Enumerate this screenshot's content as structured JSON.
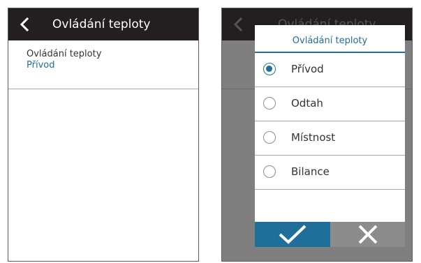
{
  "left_screen": {
    "header": {
      "title": "Ovládání teploty",
      "back_icon": "chevron-left-icon"
    },
    "setting": {
      "label": "Ovládání teploty",
      "value": "Přívod"
    }
  },
  "right_screen": {
    "header": {
      "title": "Ovládání teploty",
      "back_icon": "chevron-left-icon"
    },
    "dialog": {
      "title": "Ovládání teploty",
      "options": [
        {
          "label": "Přívod",
          "selected": true
        },
        {
          "label": "Odtah",
          "selected": false
        },
        {
          "label": "Místnost",
          "selected": false
        },
        {
          "label": "Bilance",
          "selected": false
        }
      ],
      "confirm_icon": "checkmark-icon",
      "cancel_icon": "close-icon"
    }
  },
  "colors": {
    "header_bg": "#231f20",
    "accent": "#1f6f9a",
    "cancel_bg": "#8c8c8c",
    "overlay": "#7f7f7f"
  }
}
